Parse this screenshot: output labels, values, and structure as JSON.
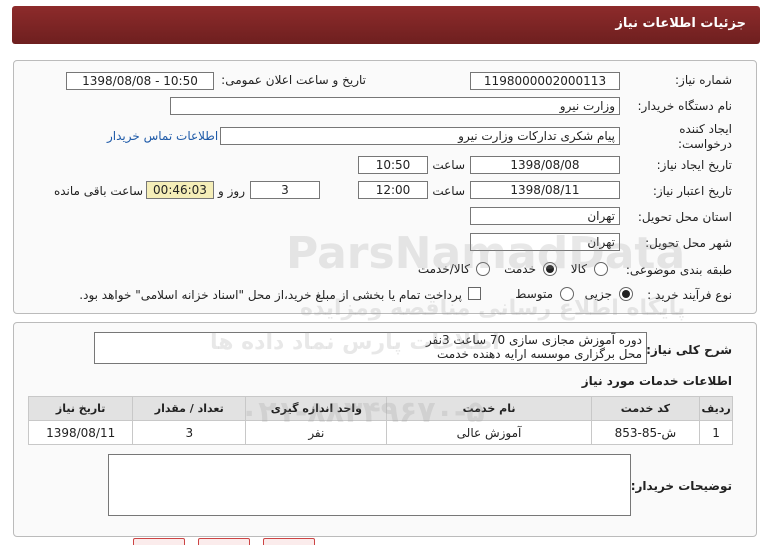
{
  "header": {
    "title": "جزئیات اطلاعات نیاز"
  },
  "form": {
    "need_number_label": "شماره نیاز:",
    "need_number": "1198000002000113",
    "announce_label": "تاریخ و ساعت اعلان عمومی:",
    "announce_value": "1398/08/08 - 10:50",
    "buyer_org_label": "نام دستگاه خریدار:",
    "buyer_org": "وزارت نیرو",
    "creator_label_1": "ایجاد کننده",
    "creator_label_2": "درخواست:",
    "creator": "پیام شکری تدارکات وزارت نیرو",
    "contact_link": "اطلاعات تماس خریدار",
    "created_date_label": "تاریخ ایجاد نیاز:",
    "created_date": "1398/08/08",
    "time_label": "ساعت",
    "created_time": "10:50",
    "validity_label": "تاریخ اعتبار نیاز:",
    "validity_date": "1398/08/11",
    "validity_time": "12:00",
    "days_label": "روز و",
    "days": "3",
    "remaining_time": "00:46:03",
    "remaining_label": "ساعت باقی مانده",
    "province_label": "استان محل تحویل:",
    "province": "تهران",
    "city_label": "شهر محل تحویل:",
    "city": "تهران",
    "category_label": "طبقه بندی موضوعی:",
    "category_options": [
      "کالا",
      "خدمت",
      "کالا/خدمت"
    ],
    "category_selected": "خدمت",
    "purchase_label": "نوع فرآیند خرید :",
    "purchase_options": [
      "جزیی",
      "متوسط"
    ],
    "purchase_selected": "جزیی",
    "payment_note": "پرداخت تمام یا بخشی از مبلغ خرید،از محل \"اسناد خزانه اسلامی\" خواهد بود."
  },
  "description": {
    "label": "شرح کلی نیاز:",
    "line1": "دوره آموزش مجازی سازی 70 ساعت 3نفر",
    "line2": "محل برگزاری موسسه ارایه دهنده خدمت"
  },
  "services": {
    "title": "اطلاعات خدمات مورد نیاز",
    "columns": [
      "ردیف",
      "کد خدمت",
      "نام خدمت",
      "واحد اندازه گیری",
      "تعداد / مقدار",
      "تاریخ نیاز"
    ],
    "rows": [
      [
        "1",
        "ش-85-853",
        "آموزش عالی",
        "نفر",
        "3",
        "1398/08/11"
      ]
    ]
  },
  "buyer_notes": {
    "label": "توضیحات خریدار:"
  },
  "watermark": {
    "line1": "پایگاه اطلاع رسانی مناقصه ومزایده",
    "line2": "ParsNamadData",
    "line3": "اطلاعات پارس نماد داده ها",
    "line4": "۰۲۱-۸۸۳۴۹۶۷۰-۵"
  }
}
